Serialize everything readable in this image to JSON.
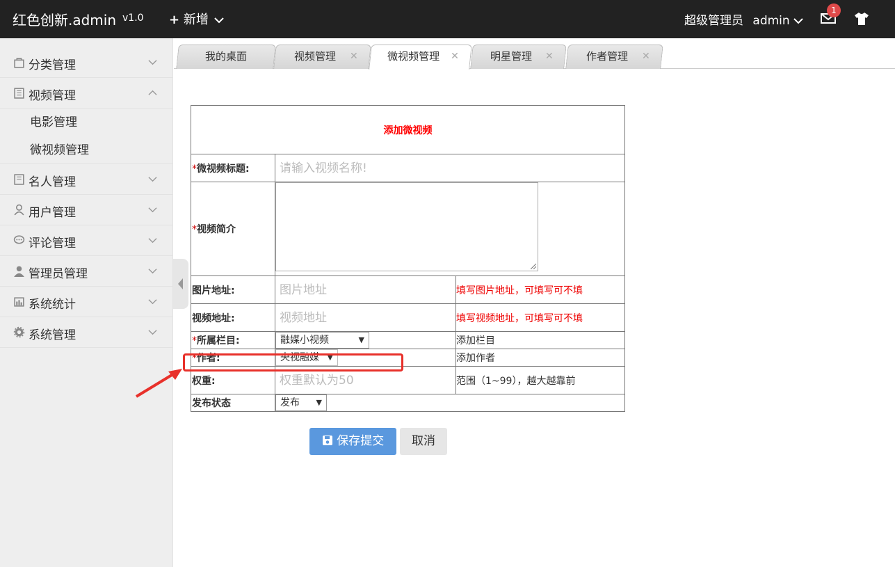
{
  "header": {
    "logo": "红色创新.admin",
    "version": "v1.0",
    "add_label": "新增",
    "user_label": "超级管理员",
    "username": "admin",
    "badge_count": "1"
  },
  "sidebar": {
    "items": [
      {
        "label": "分类管理",
        "icon": "bag-icon"
      },
      {
        "label": "视频管理",
        "icon": "book-icon",
        "expanded": true,
        "children": [
          "电影管理",
          "微视频管理"
        ]
      },
      {
        "label": "名人管理",
        "icon": "book-icon"
      },
      {
        "label": "用户管理",
        "icon": "user-icon"
      },
      {
        "label": "评论管理",
        "icon": "comment-icon"
      },
      {
        "label": "管理员管理",
        "icon": "admin-icon"
      },
      {
        "label": "系统统计",
        "icon": "stats-icon"
      },
      {
        "label": "系统管理",
        "icon": "gear-icon"
      }
    ]
  },
  "tabs": [
    "我的桌面",
    "视频管理",
    "微视频管理",
    "明星管理",
    "作者管理"
  ],
  "form": {
    "title": "添加微视频",
    "required_mark": "*",
    "title_label": "微视频标题:",
    "title_placeholder": "请输入视频名称!",
    "intro_label": "视频简介",
    "image_label": "图片地址:",
    "image_placeholder": "图片地址",
    "image_hint": "填写图片地址，可填写可不填",
    "video_label": "视频地址:",
    "video_placeholder": "视频地址",
    "video_hint": "填写视频地址，可填写可不填",
    "column_label": "所属栏目:",
    "column_value": "融媒小视频",
    "column_hint": "添加栏目",
    "author_label": "作者:",
    "author_value": "央视融媒",
    "author_hint": "添加作者",
    "weight_label": "权重:",
    "weight_placeholder": "权重默认为50",
    "weight_hint": "范围（1~99），越大越靠前",
    "status_label": "发布状态",
    "status_value": "发布"
  },
  "buttons": {
    "save": "保存提交",
    "cancel": "取消"
  },
  "colors": {
    "topbar": "#222222",
    "title_red": "#ff0000",
    "save_blue": "#5a98de",
    "highlight_red": "#e8302a"
  }
}
